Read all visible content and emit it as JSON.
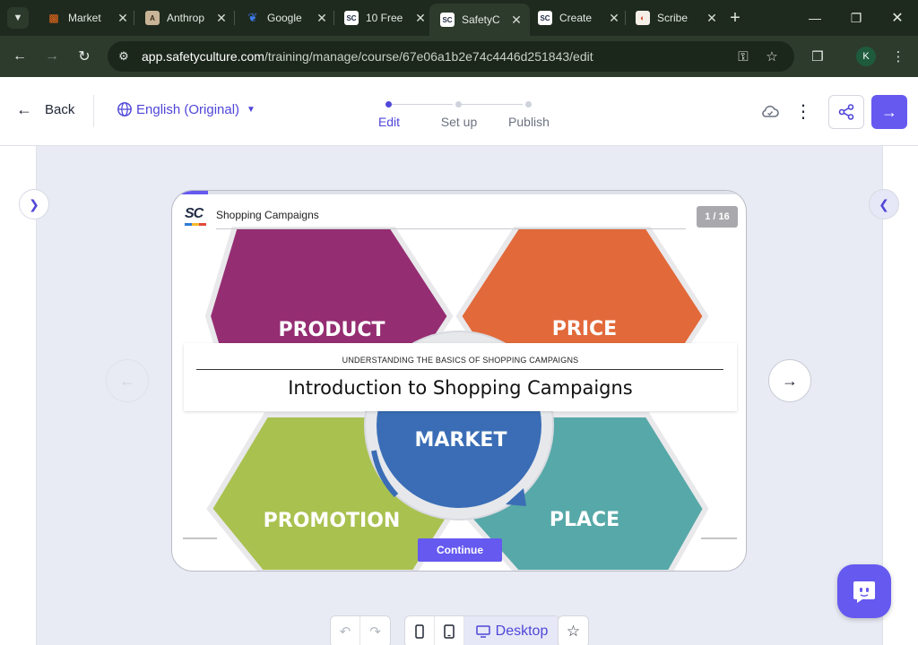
{
  "browser": {
    "tabs": [
      {
        "title": "Market",
        "favicon": "orange-grid-icon"
      },
      {
        "title": "Anthrop",
        "favicon": "anthropic-icon"
      },
      {
        "title": "Google",
        "favicon": "butterfly-icon"
      },
      {
        "title": "10 Free",
        "favicon": "sc-icon"
      },
      {
        "title": "SafetyC",
        "favicon": "sc-icon",
        "active": true
      },
      {
        "title": "Create",
        "favicon": "sc-icon"
      },
      {
        "title": "Scribe",
        "favicon": "scribe-icon"
      }
    ],
    "url_host": "app.safetyculture.com",
    "url_path": "/training/manage/course/67e06a1b2e74c4446d251843/edit",
    "profile_initial": "K"
  },
  "header": {
    "back_label": "Back",
    "language_label": "English (Original)",
    "steps": [
      {
        "label": "Edit",
        "active": true
      },
      {
        "label": "Set up",
        "active": false
      },
      {
        "label": "Publish",
        "active": false
      }
    ]
  },
  "slide": {
    "header_title": "Shopping Campaigns",
    "counter": "1 / 16",
    "progress_fraction": 0.0625,
    "card_subtitle": "UNDERSTANDING THE BASICS OF SHOPPING CAMPAIGNS",
    "card_title": "Introduction to Shopping Campaigns",
    "continue_label": "Continue",
    "diagram": {
      "center": "MARKET",
      "top_left": "PRODUCT",
      "top_right": "PRICE",
      "bottom_left": "PROMOTION",
      "bottom_right": "PLACE"
    }
  },
  "view_toggle": {
    "desktop_label": "Desktop"
  },
  "colors": {
    "accent": "#6559f0",
    "product": "#952d72",
    "price": "#e2693a",
    "promotion": "#a9c14f",
    "place": "#57a8a8",
    "market": "#3a6db5"
  }
}
